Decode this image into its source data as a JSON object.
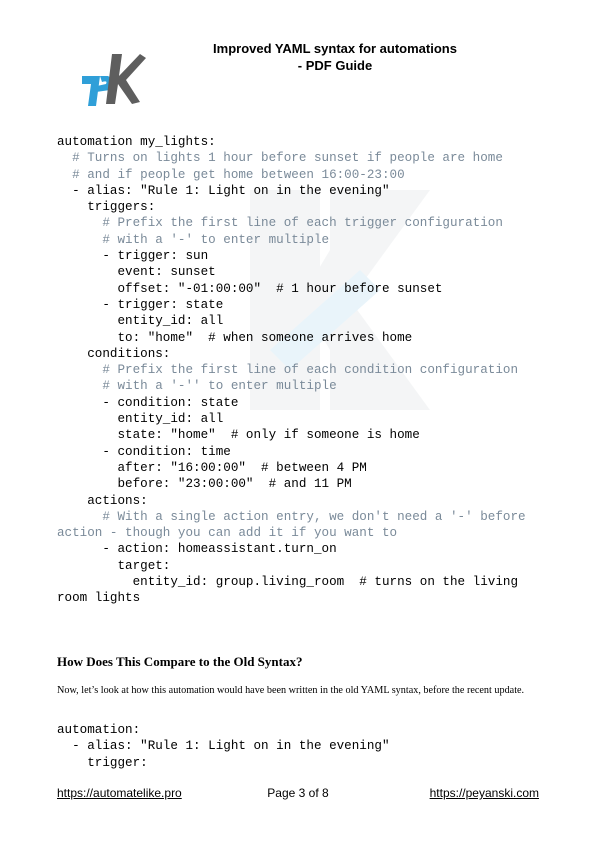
{
  "header": {
    "title_line1": "Improved YAML syntax for automations",
    "title_line2": "- PDF Guide"
  },
  "logo": {
    "icon": "pk-logo",
    "colors": [
      "#2f9fd8",
      "#5a5a5a"
    ]
  },
  "code_block_1": [
    {
      "text": "automation my_lights:",
      "comment": false
    },
    {
      "text": "  # Turns on lights 1 hour before sunset if people are home",
      "comment": true
    },
    {
      "text": "  # and if people get home between 16:00-23:00",
      "comment": true
    },
    {
      "text": "  - alias: \"Rule 1: Light on in the evening\"",
      "comment": false
    },
    {
      "text": "    triggers:",
      "comment": false
    },
    {
      "text": "      # Prefix the first line of each trigger configuration",
      "comment": true
    },
    {
      "text": "      # with a '-' to enter multiple",
      "comment": true
    },
    {
      "text": "      - trigger: sun",
      "comment": false
    },
    {
      "text": "        event: sunset",
      "comment": false
    },
    {
      "text": "        offset: \"-01:00:00\"  # 1 hour before sunset",
      "comment": false
    },
    {
      "text": "      - trigger: state",
      "comment": false
    },
    {
      "text": "        entity_id: all",
      "comment": false
    },
    {
      "text": "        to: \"home\"  # when someone arrives home",
      "comment": false
    },
    {
      "text": "    conditions:",
      "comment": false
    },
    {
      "text": "      # Prefix the first line of each condition configuration",
      "comment": true
    },
    {
      "text": "      # with a '-'' to enter multiple",
      "comment": true
    },
    {
      "text": "      - condition: state",
      "comment": false
    },
    {
      "text": "        entity_id: all",
      "comment": false
    },
    {
      "text": "        state: \"home\"  # only if someone is home",
      "comment": false
    },
    {
      "text": "      - condition: time",
      "comment": false
    },
    {
      "text": "        after: \"16:00:00\"  # between 4 PM",
      "comment": false
    },
    {
      "text": "        before: \"23:00:00\"  # and 11 PM",
      "comment": false
    },
    {
      "text": "    actions:",
      "comment": false
    },
    {
      "text": "      # With a single action entry, we don't need a '-' before",
      "comment": true
    },
    {
      "text": "action - though you can add it if you want to",
      "comment": true
    },
    {
      "text": "      - action: homeassistant.turn_on",
      "comment": false
    },
    {
      "text": "        target:",
      "comment": false
    },
    {
      "text": "          entity_id: group.living_room  # turns on the living",
      "comment": false
    },
    {
      "text": "room lights",
      "comment": false
    }
  ],
  "section": {
    "heading": "How Does This Compare to the Old Syntax?",
    "paragraph": "Now, let’s look at how this automation would have been written in the old YAML syntax, before the recent update."
  },
  "code_block_2": [
    {
      "text": "automation:",
      "comment": false
    },
    {
      "text": "  - alias: \"Rule 1: Light on in the evening\"",
      "comment": false
    },
    {
      "text": "    trigger:",
      "comment": false
    }
  ],
  "footer": {
    "left_link": "https://automatelike.pro",
    "page": "Page 3 of 8",
    "right_link": "https://peyanski.com"
  }
}
